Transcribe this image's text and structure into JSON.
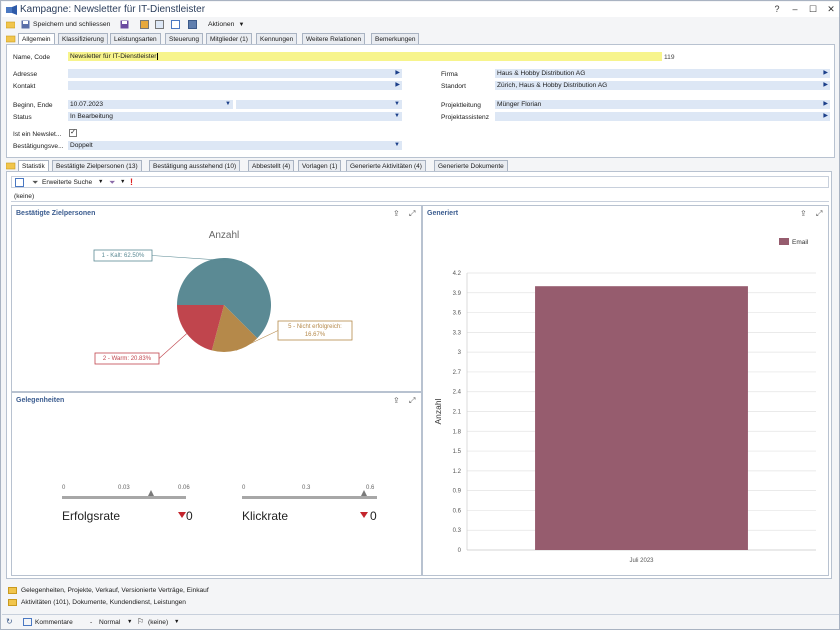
{
  "window": {
    "title": "Kampagne: Newsletter für IT-Dienstleister",
    "buttons": [
      "?",
      "–",
      "☐",
      "✕"
    ]
  },
  "toolbar": {
    "save_close": "Speichern und schliessen",
    "actions": "Aktionen"
  },
  "tabs": [
    "Allgemein",
    "Klassifizierung",
    "Leistungsarten",
    "Steuerung",
    "Mitglieder (1)",
    "Kennungen",
    "Weitere Relationen",
    "Bemerkungen"
  ],
  "form": {
    "name_label": "Name, Code",
    "name_value": "Newsletter für IT-Dienstleister",
    "code": "119",
    "adresse_label": "Adresse",
    "kontakt_label": "Kontakt",
    "firma_label": "Firma",
    "firma_value": "Haus & Hobby Distribution AG",
    "standort_label": "Standort",
    "standort_value": "Zürich, Haus & Hobby Distribution AG",
    "beginn_label": "Beginn, Ende",
    "beginn_value": "10.07.2023",
    "status_label": "Status",
    "status_value": "In Bearbeitung",
    "projektleitung_label": "Projektleitung",
    "projektleitung_value": "Münger Florian",
    "projektassistenz_label": "Projektassistenz",
    "newsletter_label": "Ist ein Newslet...",
    "bestaetigung_label": "Bestätigungsve...",
    "bestaetigung_value": "Doppelt"
  },
  "stats_tabs": [
    "Statistik",
    "Bestätigte Zielpersonen (13)",
    "Bestätigung ausstehend (10)",
    "Abbestellt (4)",
    "Vorlagen (1)",
    "Generierte Aktivitäten (4)",
    "Generierte Dokumente"
  ],
  "stats_toolbar": {
    "search": "Erweiterte Suche",
    "filter_value": "(keine)"
  },
  "panels": {
    "pie_title": "Bestätigte Zielpersonen",
    "bar_title": "Generiert",
    "opp_title": "Gelegenheiten"
  },
  "chart_data": [
    {
      "type": "pie",
      "title": "Anzahl",
      "slices": [
        {
          "label": "1 - Kalt: 62.50%",
          "value": 62.5,
          "color": "#5b8a94"
        },
        {
          "label": "5 - Nicht erfolgreich: 16.67%",
          "value": 16.67,
          "color": "#b5894a"
        },
        {
          "label": "2 - Warm: 20.83%",
          "value": 20.83,
          "color": "#c0454d"
        }
      ]
    },
    {
      "type": "bar",
      "categories": [
        "Juli 2023"
      ],
      "series": [
        {
          "name": "Email",
          "values": [
            4
          ],
          "color": "#965c6e"
        }
      ],
      "ylabel": "Anzahl",
      "ylim": [
        0,
        4.2
      ],
      "yticks": [
        "0",
        "0.3",
        "0.6",
        "0.9",
        "1.2",
        "1.5",
        "1.8",
        "2.1",
        "2.4",
        "2.7",
        "3",
        "3.3",
        "3.6",
        "3.9",
        "4.2"
      ],
      "legend": "top-right",
      "grid": true
    }
  ],
  "gauges": [
    {
      "name": "Erfolgsrate",
      "ticks": [
        "0",
        "0.03",
        "0.06"
      ],
      "value": "0",
      "pointer_fraction": 0.72
    },
    {
      "name": "Klickrate",
      "ticks": [
        "0",
        "0.3",
        "0.6"
      ],
      "value": "0",
      "pointer_fraction": 0.9
    }
  ],
  "footer_sections": [
    "Gelegenheiten, Projekte, Verkauf, Versionierte Verträge, Einkauf",
    "Aktivitäten (101), Dokumente, Kundendienst, Leistungen"
  ],
  "statusbar": {
    "comments": "Kommentare",
    "priority": "Normal",
    "flag": "(keine)"
  }
}
